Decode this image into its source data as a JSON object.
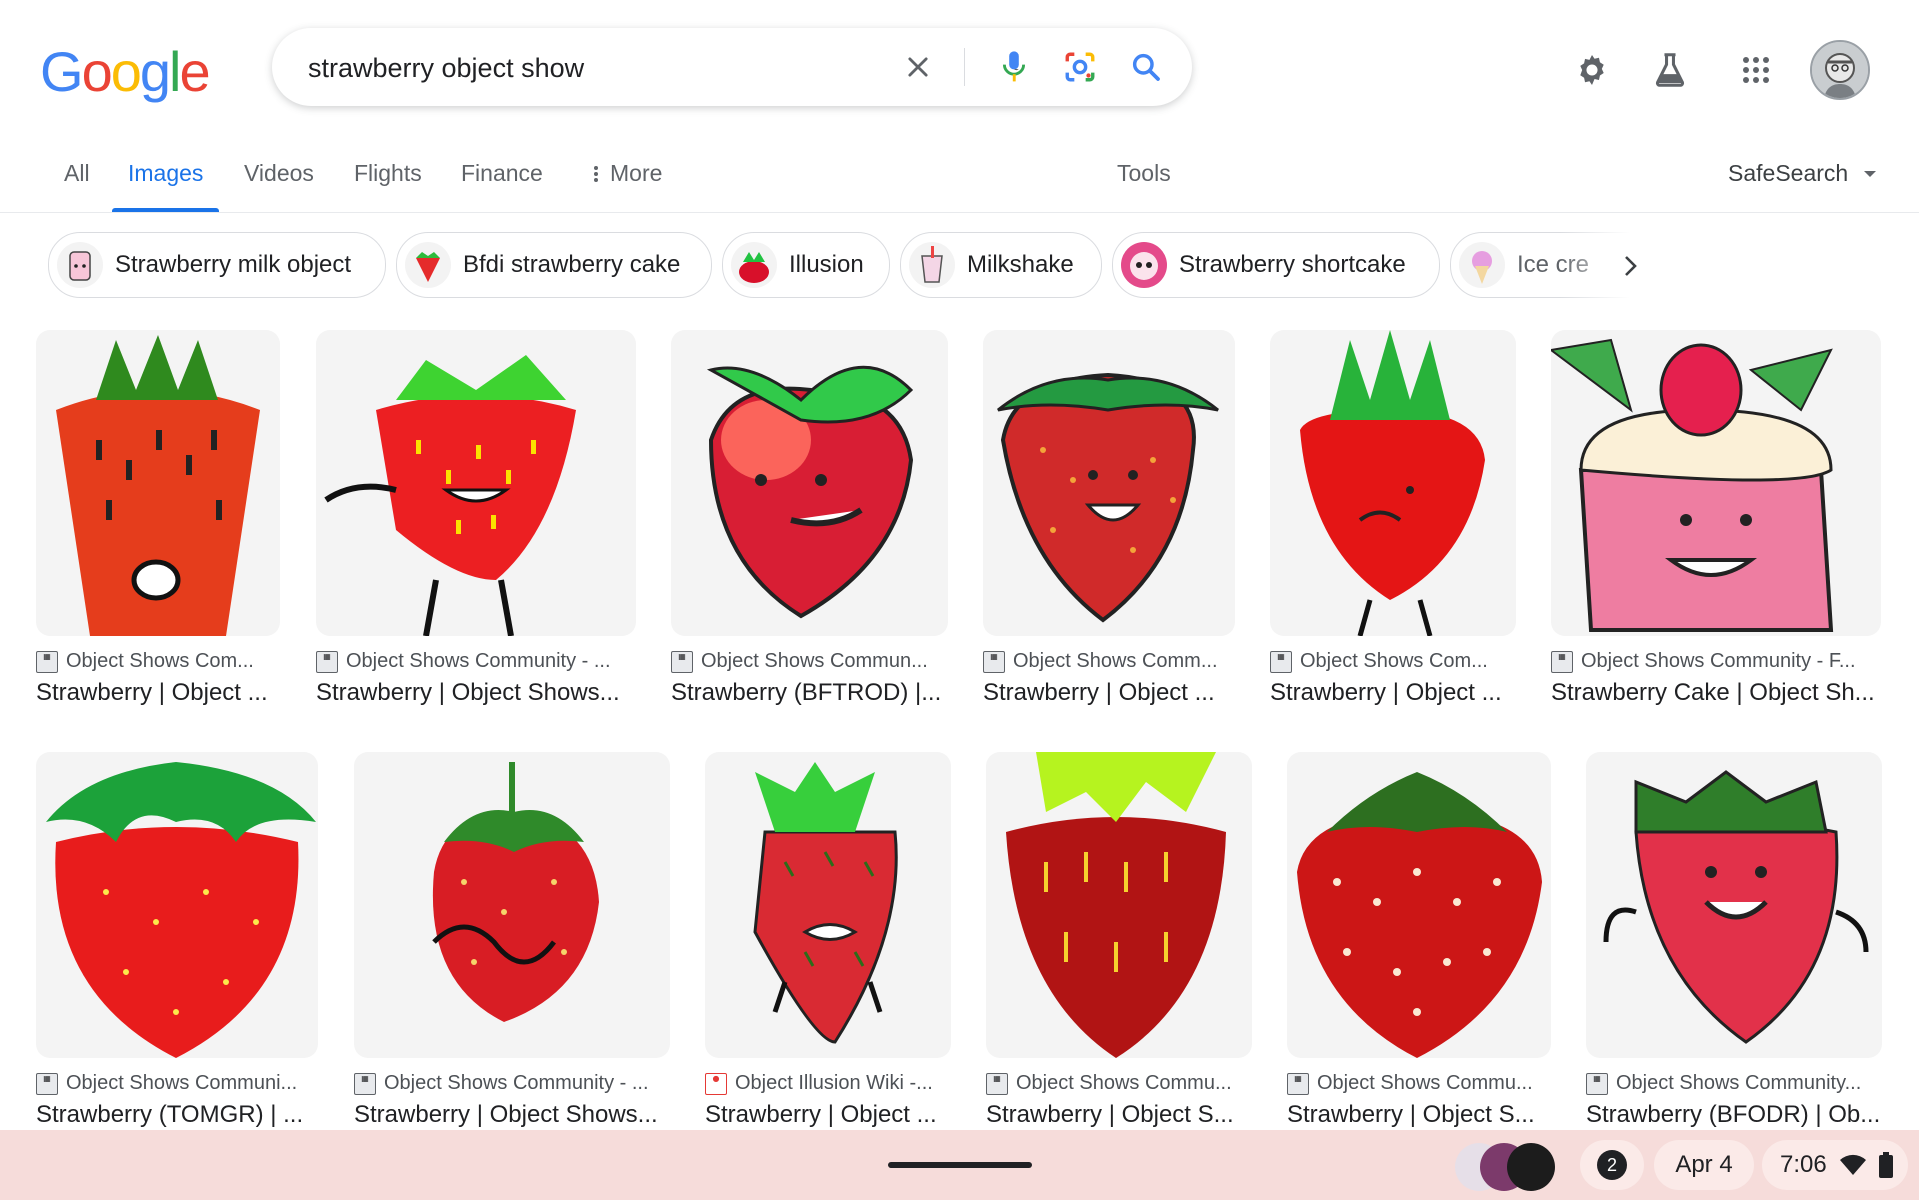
{
  "search": {
    "query": "strawberry object show"
  },
  "logo": {
    "letters": [
      "G",
      "o",
      "o",
      "g",
      "l",
      "e"
    ],
    "colors": [
      "#4285f4",
      "#ea4335",
      "#fbbc05",
      "#4285f4",
      "#34a853",
      "#ea4335"
    ]
  },
  "header_icons": [
    "settings-icon",
    "labs-flask-icon",
    "apps-grid-icon",
    "account-avatar"
  ],
  "tabs": [
    {
      "label": "All"
    },
    {
      "label": "Images",
      "active": true
    },
    {
      "label": "Videos"
    },
    {
      "label": "Flights"
    },
    {
      "label": "Finance"
    },
    {
      "label": "More"
    }
  ],
  "tools_label": "Tools",
  "safesearch_label": "SafeSearch",
  "chips": [
    {
      "label": "Strawberry milk object"
    },
    {
      "label": "Bfdi strawberry cake"
    },
    {
      "label": "Illusion"
    },
    {
      "label": "Milkshake"
    },
    {
      "label": "Strawberry shortcake"
    },
    {
      "label": "Ice cre"
    }
  ],
  "results": [
    {
      "source": "Object Shows Com...",
      "title": "Strawberry | Object ..."
    },
    {
      "source": "Object Shows Community - ...",
      "title": "Strawberry | Object Shows..."
    },
    {
      "source": "Object Shows Commun...",
      "title": "Strawberry (BFTROD) |..."
    },
    {
      "source": "Object Shows Comm...",
      "title": "Strawberry | Object ..."
    },
    {
      "source": "Object Shows Com...",
      "title": "Strawberry | Object ..."
    },
    {
      "source": "Object Shows Community - F...",
      "title": "Strawberry Cake | Object Sh..."
    },
    {
      "source": "Object Shows Communi...",
      "title": "Strawberry (TOMGR) | ..."
    },
    {
      "source": "Object Shows Community - ...",
      "title": "Strawberry | Object Shows..."
    },
    {
      "source": "Object Illusion Wiki -...",
      "title": "Strawberry | Object ..."
    },
    {
      "source": "Object Shows Commu...",
      "title": "Strawberry | Object S..."
    },
    {
      "source": "Object Shows Commu...",
      "title": "Strawberry | Object S..."
    },
    {
      "source": "Object Shows Community...",
      "title": "Strawberry (BFODR) | Ob..."
    }
  ],
  "taskbar": {
    "notifications": "2",
    "date": "Apr 4",
    "time": "7:06"
  },
  "colors": {
    "accent": "#1a73e8",
    "taskbar": "#f6dcda"
  }
}
